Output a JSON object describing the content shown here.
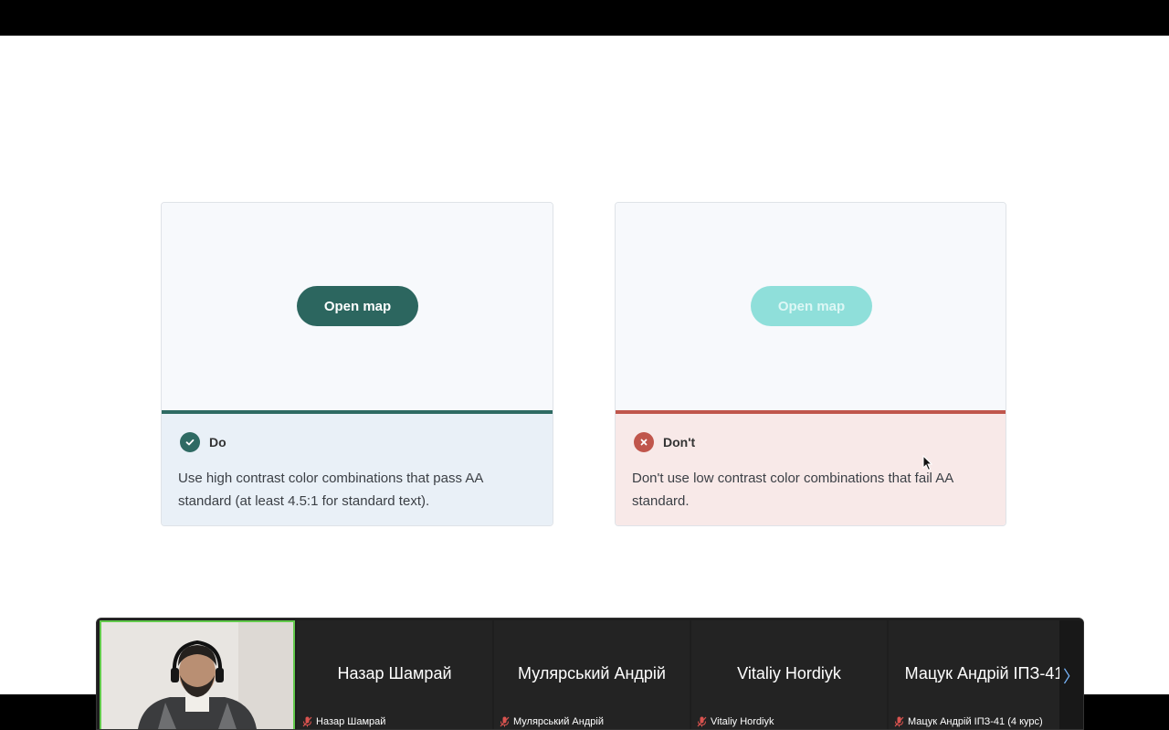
{
  "presentation": {
    "do_card": {
      "button_label": "Open map",
      "verdict_label": "Do",
      "description": "Use high contrast color combinations that pass AA standard (at least 4.5:1 for standard text).",
      "accent_color": "#2e6a63"
    },
    "dont_card": {
      "button_label": "Open map",
      "verdict_label": "Don't",
      "description": "Don't use low contrast color combinations that fail AA standard.",
      "accent_color": "#c0564c"
    }
  },
  "participants": [
    {
      "display_name": "",
      "caption": "",
      "is_self_video": true
    },
    {
      "display_name": "Назар Шамрай",
      "caption": "Назар Шамрай",
      "muted": true
    },
    {
      "display_name": "Мулярський Андрій",
      "caption": "Мулярський Андрій",
      "muted": true
    },
    {
      "display_name": "Vitaliy Hordiyk",
      "caption": "Vitaliy Hordiyk",
      "muted": true
    },
    {
      "display_name": "Мацук Андрій ІПЗ-41.",
      "caption": "Мацук Андрій ІПЗ-41 (4 курс)",
      "muted": true
    }
  ],
  "icons": {
    "do": "check-icon",
    "dont": "close-icon",
    "mic": "mic-muted-icon",
    "next": "chevron-right-icon"
  },
  "next_arrow": "〉"
}
